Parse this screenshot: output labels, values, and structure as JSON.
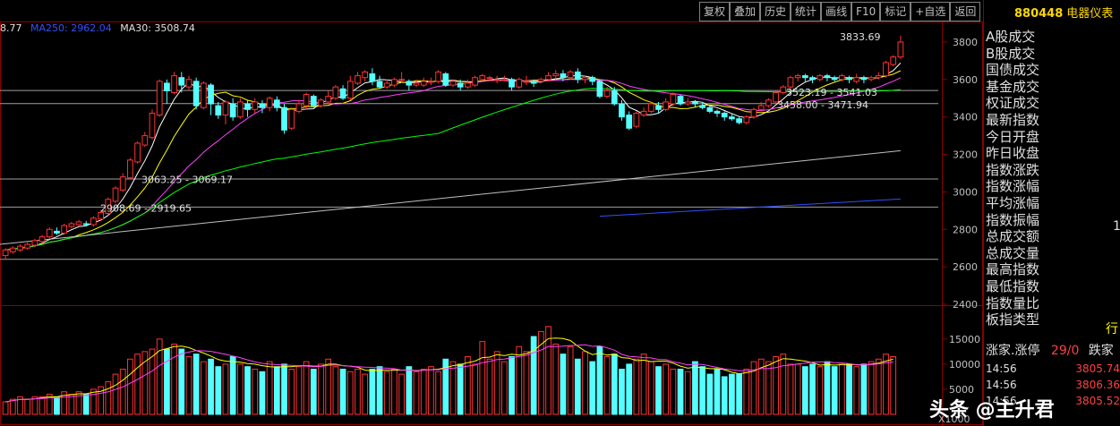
{
  "toolbar": {
    "buttons": [
      "复权",
      "叠加",
      "历史",
      "统计",
      "画线",
      "F10",
      "标记",
      "+自选",
      "返回"
    ]
  },
  "ma_legend": {
    "truncated_value": "8.77",
    "ma250_label": "MA250: 2962.04",
    "ma30_label": "MA30: 3508.74",
    "ma250_color": "#3050ff",
    "ma30_color": "#e0e0e0"
  },
  "sidebar": {
    "code": "880448",
    "name": "电器仪表",
    "items": [
      "A股成交",
      "B股成交",
      "国债成交",
      "基金成交",
      "权证成交",
      "最新指数",
      "今日开盘",
      "昨日收盘",
      "指数涨跌",
      "指数涨幅",
      "平均涨幅",
      "指数振幅",
      "总成交额",
      "总成交量",
      "最高指数",
      "最低指数",
      "指数量比",
      "板指类型"
    ],
    "amplitude_value": "1",
    "type_value": "行",
    "breadth_label": "涨家.涨停",
    "breadth_value": "29/0",
    "breadth_right": "跌家",
    "ticks": [
      {
        "time": "14:56",
        "price": "3805.74"
      },
      {
        "time": "14:56",
        "price": "3806.36"
      },
      {
        "time": "14:56",
        "price": "3805.52"
      }
    ]
  },
  "watermark": "头条 @主升君",
  "price_axis_labels": [
    "3800",
    "3600",
    "3400",
    "3200",
    "3000",
    "2800",
    "2600",
    "2400"
  ],
  "volume_axis_labels": [
    "15000",
    "10000",
    "5000"
  ],
  "volume_unit": "X1000",
  "colors": {
    "up": "#ff3232",
    "down": "#54ffff",
    "ma5": "#ffffff",
    "ma10": "#ffff00",
    "ma20": "#ff40ff",
    "ma60": "#00ff00",
    "ma120": "#c0c0c0",
    "ma250": "#3050ff",
    "grid": "#8b0000"
  },
  "chart_data": {
    "type": "candlestick",
    "ylim": [
      2400,
      3900
    ],
    "volume_ylim": [
      0,
      18000
    ],
    "annotations": [
      {
        "text": "3833.69",
        "value": 3833.69
      },
      {
        "text": "3063.25 - 3069.17",
        "value": 3066
      },
      {
        "text": "2908.69 - 2919.65",
        "value": 2914
      },
      {
        "text": "3523.19 - 3541.03",
        "value": 3532
      },
      {
        "text": "3458.00 - 3471.94",
        "value": 3465
      }
    ],
    "horizontal_levels": [
      3541,
      3471,
      3069,
      2919,
      2640
    ],
    "ma250": {
      "start": 2870,
      "end": 2962.04
    },
    "ma120": {
      "start": 2720,
      "end": 3220
    },
    "candles": [
      [
        2660,
        2690,
        2640,
        2700
      ],
      [
        2680,
        2700,
        2670,
        2710
      ],
      [
        2690,
        2710,
        2680,
        2720
      ],
      [
        2700,
        2720,
        2690,
        2730
      ],
      [
        2715,
        2740,
        2705,
        2750
      ],
      [
        2735,
        2760,
        2725,
        2770
      ],
      [
        2760,
        2800,
        2750,
        2810
      ],
      [
        2790,
        2780,
        2770,
        2810
      ],
      [
        2780,
        2820,
        2770,
        2830
      ],
      [
        2815,
        2830,
        2805,
        2840
      ],
      [
        2825,
        2840,
        2815,
        2850
      ],
      [
        2830,
        2825,
        2815,
        2845
      ],
      [
        2825,
        2860,
        2815,
        2870
      ],
      [
        2855,
        2890,
        2845,
        2900
      ],
      [
        2885,
        2960,
        2875,
        2970
      ],
      [
        2950,
        3020,
        2940,
        3030
      ],
      [
        3010,
        3080,
        3000,
        3100
      ],
      [
        3075,
        3170,
        3065,
        3180
      ],
      [
        3160,
        3260,
        3150,
        3270
      ],
      [
        3250,
        3300,
        3240,
        3320
      ],
      [
        3290,
        3420,
        3280,
        3440
      ],
      [
        3410,
        3590,
        3400,
        3600
      ],
      [
        3580,
        3540,
        3470,
        3600
      ],
      [
        3530,
        3620,
        3520,
        3640
      ],
      [
        3610,
        3570,
        3530,
        3640
      ],
      [
        3560,
        3600,
        3540,
        3620
      ],
      [
        3590,
        3460,
        3440,
        3610
      ],
      [
        3450,
        3580,
        3440,
        3590
      ],
      [
        3570,
        3470,
        3410,
        3580
      ],
      [
        3460,
        3410,
        3390,
        3480
      ],
      [
        3410,
        3480,
        3360,
        3490
      ],
      [
        3470,
        3400,
        3380,
        3500
      ],
      [
        3400,
        3480,
        3390,
        3500
      ],
      [
        3470,
        3440,
        3400,
        3490
      ],
      [
        3440,
        3480,
        3420,
        3500
      ],
      [
        3470,
        3450,
        3420,
        3490
      ],
      [
        3450,
        3500,
        3430,
        3510
      ],
      [
        3490,
        3450,
        3430,
        3510
      ],
      [
        3450,
        3330,
        3310,
        3470
      ],
      [
        3340,
        3440,
        3330,
        3450
      ],
      [
        3430,
        3470,
        3420,
        3490
      ],
      [
        3460,
        3520,
        3440,
        3530
      ],
      [
        3510,
        3460,
        3450,
        3520
      ],
      [
        3460,
        3490,
        3450,
        3500
      ],
      [
        3480,
        3510,
        3470,
        3540
      ],
      [
        3500,
        3560,
        3490,
        3570
      ],
      [
        3550,
        3500,
        3490,
        3570
      ],
      [
        3500,
        3590,
        3490,
        3620
      ],
      [
        3580,
        3620,
        3570,
        3640
      ],
      [
        3610,
        3640,
        3590,
        3650
      ],
      [
        3630,
        3590,
        3570,
        3660
      ],
      [
        3590,
        3560,
        3550,
        3620
      ],
      [
        3560,
        3580,
        3550,
        3600
      ],
      [
        3570,
        3600,
        3560,
        3610
      ],
      [
        3600,
        3600,
        3580,
        3640
      ],
      [
        3590,
        3570,
        3540,
        3600
      ],
      [
        3570,
        3580,
        3560,
        3600
      ],
      [
        3570,
        3590,
        3560,
        3610
      ],
      [
        3590,
        3590,
        3570,
        3610
      ],
      [
        3590,
        3640,
        3580,
        3650
      ],
      [
        3630,
        3570,
        3560,
        3640
      ],
      [
        3570,
        3590,
        3560,
        3600
      ],
      [
        3580,
        3560,
        3540,
        3600
      ],
      [
        3560,
        3580,
        3550,
        3600
      ],
      [
        3570,
        3610,
        3560,
        3620
      ],
      [
        3600,
        3620,
        3590,
        3630
      ],
      [
        3610,
        3610,
        3590,
        3620
      ],
      [
        3600,
        3600,
        3580,
        3620
      ],
      [
        3600,
        3600,
        3590,
        3620
      ],
      [
        3600,
        3560,
        3540,
        3610
      ],
      [
        3560,
        3600,
        3550,
        3610
      ],
      [
        3590,
        3590,
        3570,
        3620
      ],
      [
        3590,
        3580,
        3560,
        3600
      ],
      [
        3590,
        3600,
        3580,
        3610
      ],
      [
        3600,
        3620,
        3590,
        3640
      ],
      [
        3620,
        3630,
        3600,
        3650
      ],
      [
        3630,
        3610,
        3590,
        3650
      ],
      [
        3610,
        3640,
        3600,
        3650
      ],
      [
        3640,
        3600,
        3580,
        3660
      ],
      [
        3600,
        3610,
        3580,
        3620
      ],
      [
        3610,
        3590,
        3570,
        3620
      ],
      [
        3590,
        3510,
        3500,
        3600
      ],
      [
        3510,
        3540,
        3500,
        3560
      ],
      [
        3540,
        3470,
        3460,
        3560
      ],
      [
        3470,
        3400,
        3380,
        3490
      ],
      [
        3410,
        3340,
        3330,
        3430
      ],
      [
        3350,
        3420,
        3340,
        3430
      ],
      [
        3410,
        3430,
        3400,
        3450
      ],
      [
        3430,
        3470,
        3420,
        3480
      ],
      [
        3460,
        3440,
        3420,
        3480
      ],
      [
        3440,
        3480,
        3430,
        3500
      ],
      [
        3470,
        3520,
        3460,
        3530
      ],
      [
        3510,
        3470,
        3460,
        3520
      ],
      [
        3470,
        3480,
        3460,
        3500
      ],
      [
        3480,
        3470,
        3450,
        3490
      ],
      [
        3460,
        3450,
        3440,
        3480
      ],
      [
        3450,
        3430,
        3420,
        3460
      ],
      [
        3430,
        3420,
        3400,
        3440
      ],
      [
        3420,
        3400,
        3380,
        3430
      ],
      [
        3400,
        3390,
        3380,
        3420
      ],
      [
        3390,
        3370,
        3360,
        3400
      ],
      [
        3370,
        3400,
        3360,
        3410
      ],
      [
        3400,
        3440,
        3390,
        3450
      ],
      [
        3440,
        3460,
        3430,
        3480
      ],
      [
        3460,
        3490,
        3450,
        3500
      ],
      [
        3480,
        3530,
        3470,
        3540
      ],
      [
        3530,
        3560,
        3520,
        3570
      ],
      [
        3560,
        3610,
        3550,
        3620
      ],
      [
        3610,
        3620,
        3590,
        3630
      ],
      [
        3620,
        3610,
        3590,
        3630
      ],
      [
        3610,
        3600,
        3580,
        3620
      ],
      [
        3600,
        3620,
        3590,
        3630
      ],
      [
        3620,
        3610,
        3590,
        3630
      ],
      [
        3610,
        3600,
        3590,
        3620
      ],
      [
        3600,
        3620,
        3590,
        3630
      ],
      [
        3610,
        3600,
        3580,
        3620
      ],
      [
        3590,
        3610,
        3580,
        3630
      ],
      [
        3610,
        3600,
        3580,
        3620
      ],
      [
        3600,
        3610,
        3590,
        3620
      ],
      [
        3610,
        3620,
        3600,
        3640
      ],
      [
        3620,
        3690,
        3610,
        3700
      ],
      [
        3680,
        3720,
        3670,
        3730
      ],
      [
        3720,
        3800,
        3710,
        3833.69
      ]
    ],
    "volumes": [
      2500,
      3000,
      3500,
      3000,
      3500,
      3500,
      4000,
      3500,
      4500,
      4000,
      4500,
      4000,
      5000,
      5500,
      6500,
      8000,
      9000,
      11000,
      12000,
      12500,
      13000,
      15000,
      13000,
      14000,
      13000,
      11500,
      12000,
      10500,
      11000,
      9500,
      10000,
      11500,
      10000,
      9500,
      9000,
      8500,
      10500,
      9500,
      10000,
      9000,
      9500,
      10500,
      9000,
      10000,
      11000,
      9500,
      9000,
      8500,
      9000,
      8000,
      9000,
      9500,
      8500,
      9000,
      8000,
      9500,
      8500,
      9000,
      9500,
      8500,
      11000,
      10500,
      10000,
      11500,
      10000,
      14500,
      11000,
      12500,
      10500,
      11500,
      13500,
      12500,
      15500,
      16500,
      17500,
      14000,
      12000,
      13500,
      11000,
      12500,
      10500,
      13500,
      11500,
      12000,
      9000,
      10000,
      11000,
      12000,
      10500,
      9500,
      10000,
      9000,
      9000,
      8500,
      10500,
      9500,
      8000,
      9000,
      7500,
      8000,
      8000,
      9000,
      10500,
      11000,
      10500,
      11500,
      12000,
      10000,
      10000,
      9500,
      10000,
      9500,
      10500,
      9500,
      10000,
      10000,
      9500,
      10000,
      10500,
      11000,
      12000,
      11500
    ]
  }
}
